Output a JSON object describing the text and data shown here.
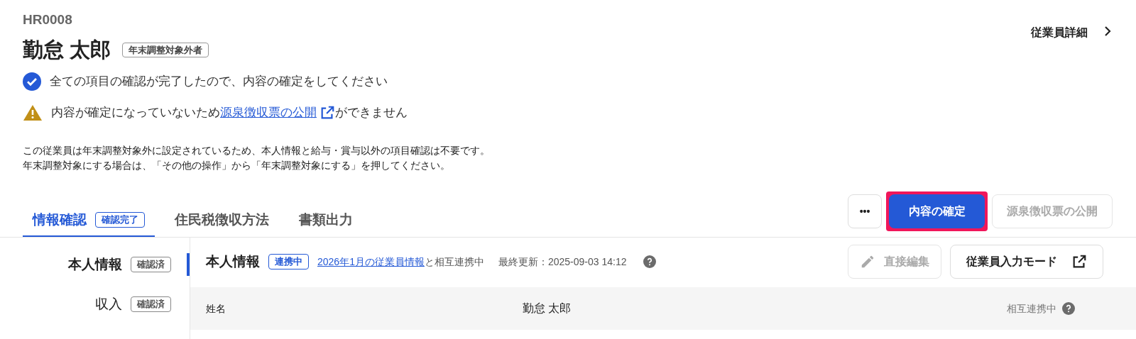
{
  "employee": {
    "code": "HR0008",
    "name": "勤怠 太郎",
    "tag": "年末調整対象外者"
  },
  "detail_link": {
    "label": "従業員詳細"
  },
  "messages": [
    {
      "kind": "success",
      "text": "全ての項目の確認が完了したので、内容の確定をしてください"
    },
    {
      "kind": "warning",
      "before": "内容が確定になっていないため",
      "link": "源泉徴収票の公開",
      "after": "ができません"
    }
  ],
  "notice": [
    "この従業員は年末調整対象外に設定されているため、本人情報と給与・賞与以外の項目確認は不要です。",
    "年末調整対象にする場合は、「その他の操作」から「年末調整対象にする」を押してください。"
  ],
  "tabs": [
    {
      "label": "情報確認",
      "badge": "確認完了",
      "selected": true
    },
    {
      "label": "住民税徴収方法",
      "selected": false
    },
    {
      "label": "書類出力",
      "selected": false
    }
  ],
  "actions": {
    "more": "•••",
    "confirm": {
      "label": "内容の確定",
      "highlighted": true
    },
    "publish": {
      "label": "源泉徴収票の公開",
      "disabled": true
    }
  },
  "sidebar": {
    "items": [
      {
        "label": "本人情報",
        "badge": "確認済",
        "selected": true
      },
      {
        "label": "収入",
        "badge": "確認済",
        "selected": false
      }
    ]
  },
  "section": {
    "title": "本人情報",
    "badge": "連携中",
    "link": "2026年1月の従業員情報",
    "link_suffix": "と相互連携中",
    "updated": "最終更新：2025-09-03 14:12",
    "edit": {
      "label": "直接編集",
      "disabled": true
    },
    "mode_button": "従業員入力モード"
  },
  "fields": [
    {
      "label": "姓名",
      "value": "勤怠 太郎",
      "status": "相互連携中"
    }
  ]
}
